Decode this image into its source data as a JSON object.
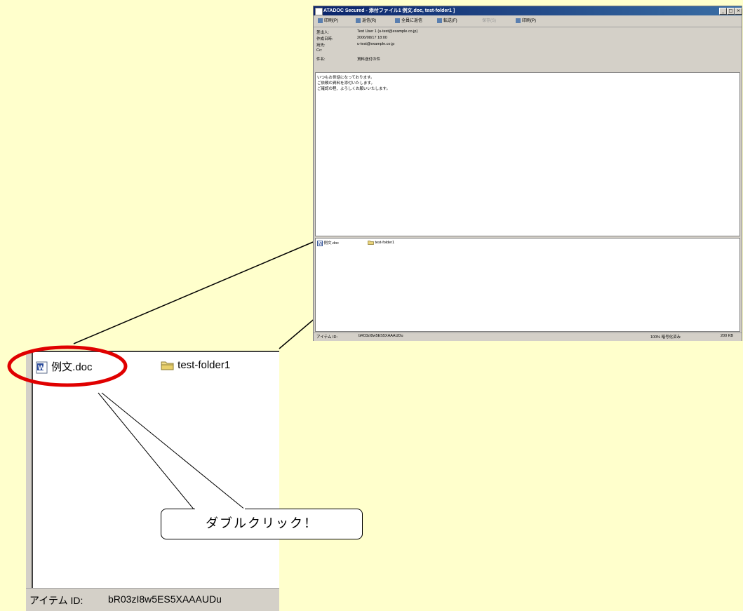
{
  "mail_window": {
    "title": "ATADOC Secured - 添付ファイル1 例文.doc, test-folder1 ]",
    "toolbar": {
      "print": "印刷(P)",
      "reply": "返信(R)",
      "reply_all": "全員に返信",
      "forward": "転送(F)",
      "disabled_action": "保存(S)",
      "print_preview": "印刷(P)"
    },
    "header": {
      "from_label": "差出人:",
      "from_value": "Test User 1 (u-test@example.co.jp)",
      "date_label": "作成日時:",
      "date_value": "2006/08/17 18:00",
      "to_label": "宛先:",
      "to_value": "u-test@example.co.jp",
      "cc_label": "Cc:",
      "cc_value": "",
      "subject_label": "件名:",
      "subject_value": "資料送付の件"
    },
    "body_lines": [
      "いつもお世話になっております。",
      "ご依頼の資料を添付いたします。",
      "ご確認の程、よろしくお願いいたします。"
    ],
    "attachments": {
      "file1": "例文.doc",
      "folder1": "test-folder1"
    },
    "status": {
      "item_id_label": "アイテム ID:",
      "item_id_value": "bR03zI8w5ES5XAAAUDu",
      "right1": "100% 暗号化済み",
      "right2": "200 KB"
    },
    "window_buttons": {
      "minimize": "_",
      "maximize": "□",
      "close": "×"
    }
  },
  "zoom": {
    "file_name": "例文.doc",
    "folder_name": "test-folder1",
    "item_id_label": "アイテム ID:",
    "item_id_value": "bR03zI8w5ES5XAAAUDu"
  },
  "callout_text": "ダブルクリック！",
  "colors": {
    "background": "#ffffcc",
    "highlight_ellipse": "#e00000",
    "titlebar": "#0a246a"
  }
}
